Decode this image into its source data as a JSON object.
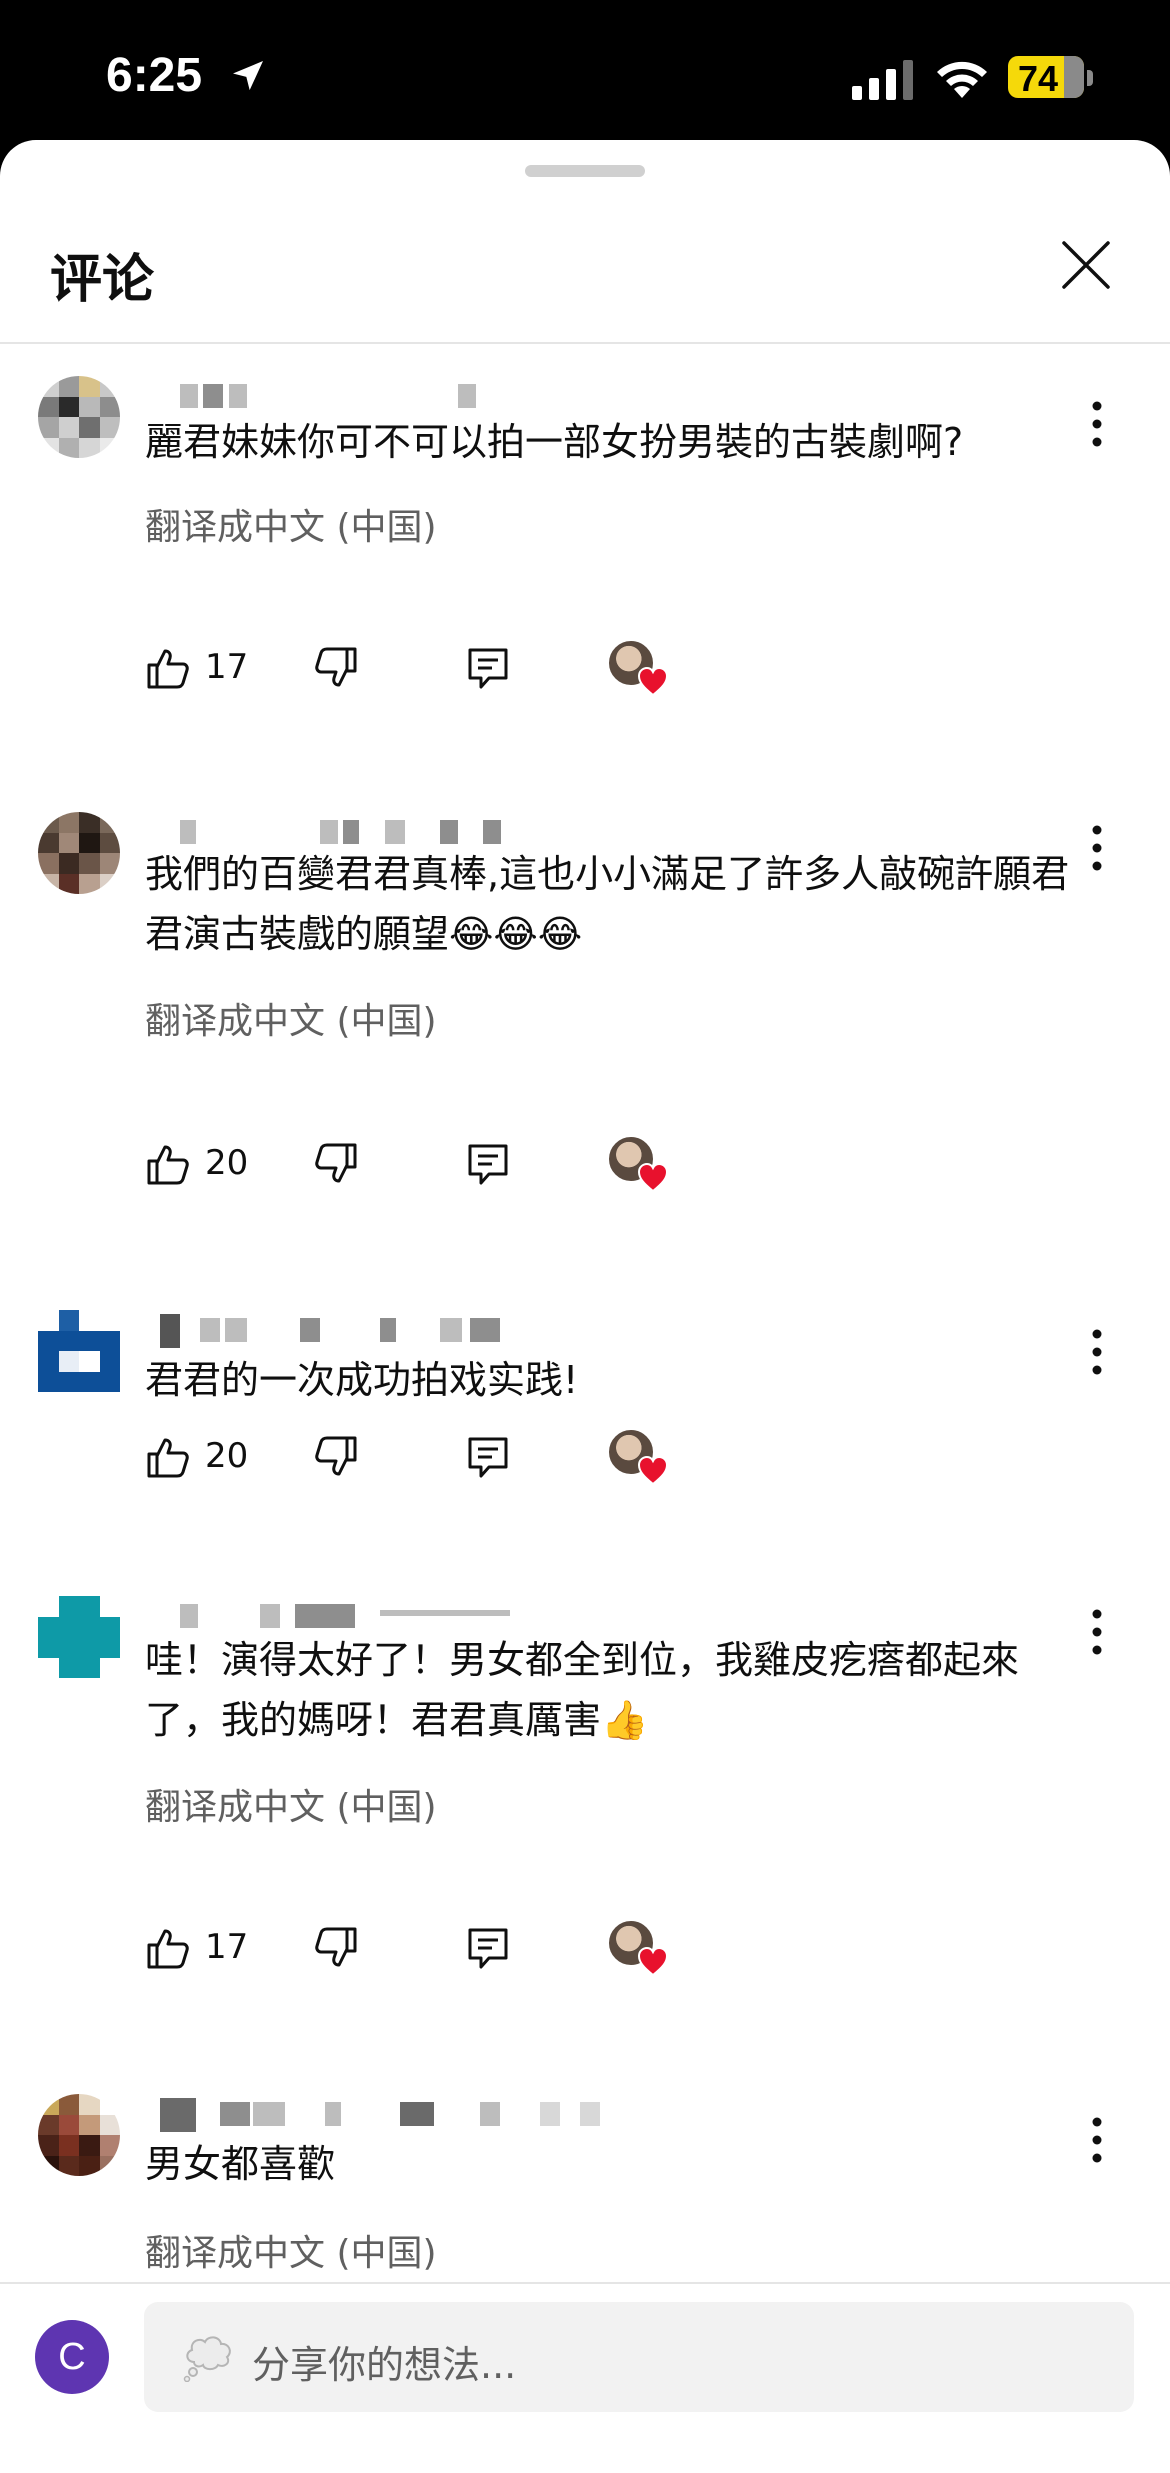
{
  "status_bar": {
    "time": "6:25",
    "battery": "74",
    "battery_level": 0.74
  },
  "sheet": {
    "title": "评论"
  },
  "comments": [
    {
      "text": "麗君妹妹你可不可以拍一部女扮男裝的古裝劇啊?",
      "translate": "翻译成中文 (中国)",
      "likes": "17"
    },
    {
      "text": "我們的百變君君真棒,這也小小滿足了許多人敲碗許願君君演古裝戲的願望😂😂😂",
      "translate": "翻译成中文 (中国)",
      "likes": "20"
    },
    {
      "text": "君君的一次成功拍戏实践!",
      "likes": "20"
    },
    {
      "text": "哇！演得太好了！男女都全到位，我雞皮疙瘩都起來了，我的媽呀！君君真厲害👍",
      "translate": "翻译成中文 (中国)",
      "likes": "17"
    },
    {
      "text": "男女都喜歡",
      "translate": "翻译成中文 (中国)"
    }
  ],
  "footer": {
    "user_initial": "C",
    "input_placeholder": "分享你的想法..."
  },
  "colors": {
    "battery": "#f5d90a",
    "heart": "#e8112d",
    "user_avatar": "#5e35b1",
    "secondary_text": "#606060"
  }
}
